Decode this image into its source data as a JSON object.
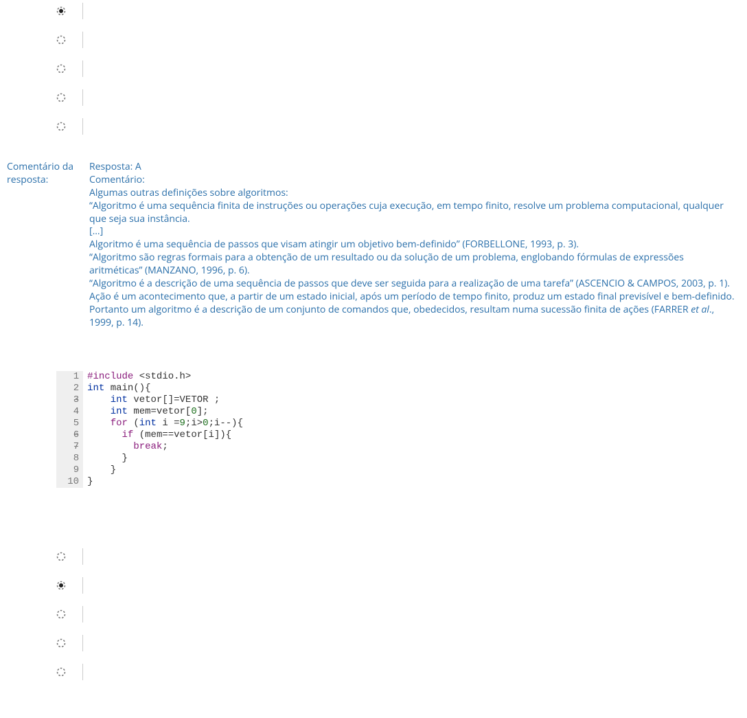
{
  "question1": {
    "options_count": 5,
    "selected_index": 0
  },
  "comment": {
    "label": "Comentário da resposta:",
    "title_line": "Resposta: A",
    "header2": "Comentário:",
    "lines": [
      "Algumas outras definições sobre algoritmos:",
      "“Algoritmo é uma sequência finita de instruções ou operações cuja execução, em tempo finito, resolve um problema computacional, qualquer que seja sua instância.",
      "[...]",
      "Algoritmo é uma sequência de passos que visam atingir um objetivo bem-definido” (FORBELLONE, 1993, p. 3).",
      "“Algoritmo são regras formais para a obtenção de um resultado ou da solução de um problema, englobando fórmulas de expressões aritméticas” (MANZANO, 1996, p. 6).",
      "“Algoritmo é a descrição de uma sequência de passos que deve ser seguida para a realização de uma tarefa” (ASCENCIO & CAMPOS, 2003, p. 1).",
      "Ação é um acontecimento que, a partir de um estado inicial, após um período de tempo finito, produz um estado final previsível e bem-definido."
    ],
    "last_line_pre": "Portanto um algoritmo é a descrição de um conjunto de comandos que, obedecidos, resultam numa sucessão finita de ações (FARRER ",
    "last_line_em": "et al",
    "last_line_post": "., 1999, p. 14)."
  },
  "code": {
    "gutter": [
      "1",
      "2 –",
      "3",
      "4",
      "5 –",
      "6 –",
      "7",
      "8",
      "9",
      "10"
    ],
    "l1_a": "#include ",
    "l1_b": "<stdio.h>",
    "l2_a": "int ",
    "l2_b": "main(){",
    "l3_a": "    ",
    "l3_b": "int ",
    "l3_c": "vetor[]=VETOR ;",
    "l4_a": "    ",
    "l4_b": "int ",
    "l4_c": "mem=vetor[",
    "l4_d": "0",
    "l4_e": "];",
    "l5_a": "    ",
    "l5_b": "for ",
    "l5_c": "(",
    "l5_d": "int ",
    "l5_e": "i =",
    "l5_f": "9",
    "l5_g": ";i>",
    "l5_h": "0",
    "l5_i": ";i--){",
    "l6_a": "      ",
    "l6_b": "if ",
    "l6_c": "(mem==vetor[i]){",
    "l7_a": "        ",
    "l7_b": "break",
    "l7_c": ";",
    "l8": "      }",
    "l9": "    }",
    "l10": "}"
  },
  "question2": {
    "options_count": 5,
    "selected_index": 1
  }
}
